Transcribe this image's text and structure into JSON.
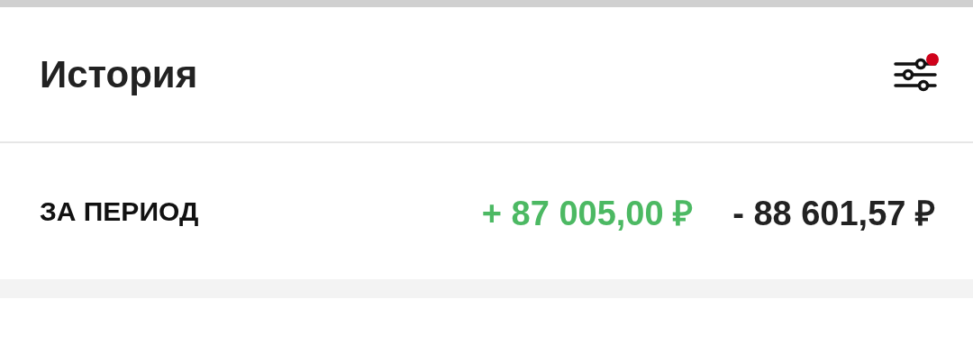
{
  "header": {
    "title": "История",
    "filter": {
      "active": true
    }
  },
  "period": {
    "label": "ЗА ПЕРИОД",
    "income": "+ 87 005,00 ₽",
    "expense": "- 88 601,57 ₽"
  }
}
